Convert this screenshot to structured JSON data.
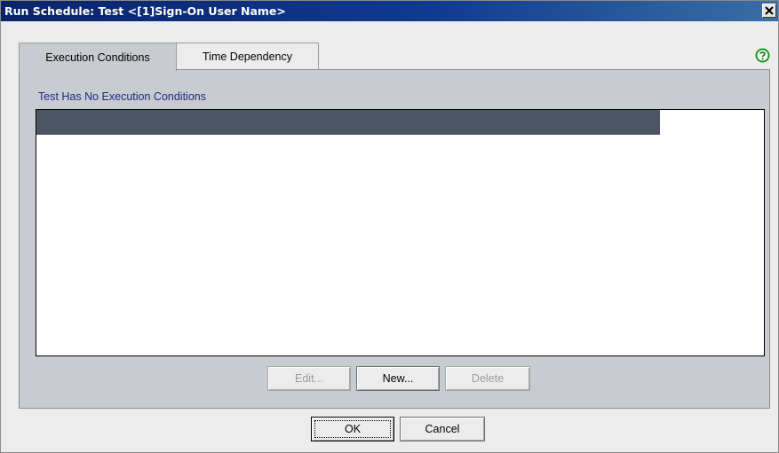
{
  "window": {
    "title": "Run Schedule: Test <[1]Sign-On User Name>",
    "close_icon": "close-icon"
  },
  "tabs": [
    {
      "label": "Execution Conditions",
      "active": true
    },
    {
      "label": "Time Dependency",
      "active": false
    }
  ],
  "help": {
    "icon": "help-icon",
    "color": "#1a9a1a"
  },
  "panel": {
    "conditions_label": "Test Has No Execution Conditions",
    "list_items": [],
    "buttons": {
      "edit": {
        "label": "Edit...",
        "enabled": false
      },
      "new": {
        "label": "New...",
        "enabled": true
      },
      "delete": {
        "label": "Delete",
        "enabled": false
      }
    }
  },
  "footer": {
    "ok_label": "OK",
    "cancel_label": "Cancel"
  },
  "colors": {
    "titlebar": "#0a246a",
    "panel_bg": "#c8cbcf",
    "list_header": "#4b5563",
    "label_text": "#1a2a8a"
  }
}
